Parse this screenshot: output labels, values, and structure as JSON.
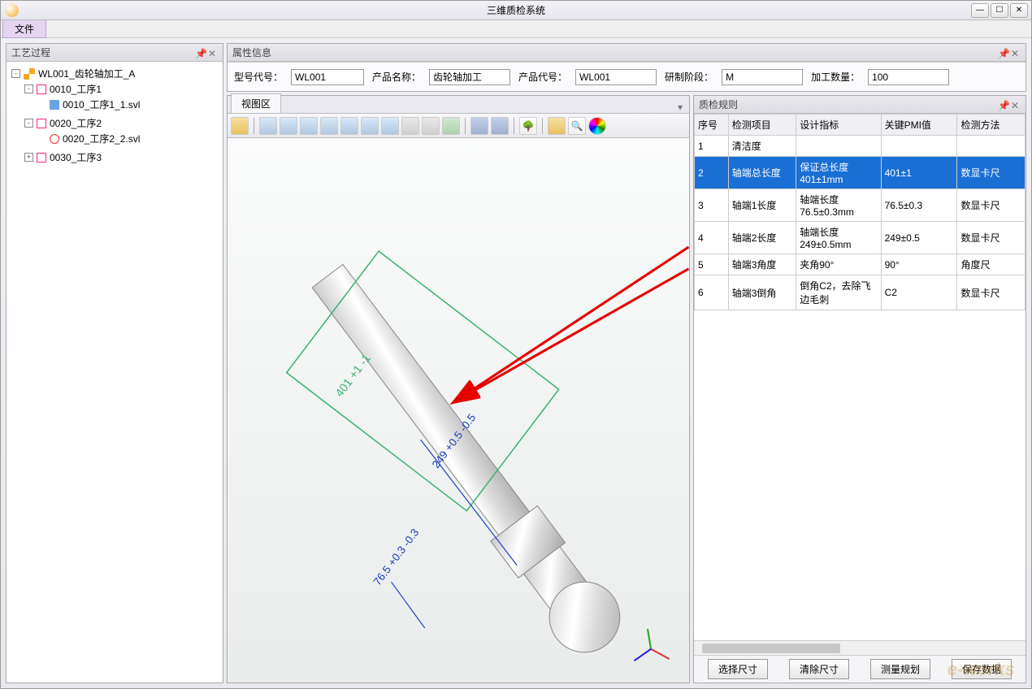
{
  "titlebar": {
    "title": "三维质检系统"
  },
  "menubar": {
    "file": "文件"
  },
  "left": {
    "title": "工艺过程",
    "tree": {
      "root": "WL001_齿轮轴加工_A",
      "n1": "0010_工序1",
      "n1a": "0010_工序1_1.svl",
      "n2": "0020_工序2",
      "n2a": "0020_工序2_2.svl",
      "n3": "0030_工序3"
    }
  },
  "attr": {
    "title": "属性信息",
    "model_code_lbl": "型号代号：",
    "model_code": "WL001",
    "product_name_lbl": "产品名称：",
    "product_name": "齿轮轴加工",
    "product_code_lbl": "产品代号：",
    "product_code": "WL001",
    "phase_lbl": "研制阶段：",
    "phase": "M",
    "qty_lbl": "加工数量：",
    "qty": "100"
  },
  "view": {
    "tab": "视图区"
  },
  "dims": {
    "d401": "401 +1 -1",
    "d249": "249 +0.5 -0.5",
    "d76": "76.5 +0.3 -0.3"
  },
  "rules": {
    "title": "质检规则",
    "cols": {
      "c1": "序号",
      "c2": "检测项目",
      "c3": "设计指标",
      "c4": "关键PMI值",
      "c5": "检测方法"
    },
    "r1": {
      "no": "1",
      "item": "清洁度",
      "design": "",
      "pmi": "",
      "method": ""
    },
    "r2": {
      "no": "2",
      "item": "轴端总长度",
      "design": "保证总长度401±1mm",
      "pmi": "401±1",
      "method": "数显卡尺"
    },
    "r3": {
      "no": "3",
      "item": "轴端1长度",
      "design": "轴端长度76.5±0.3mm",
      "pmi": "76.5±0.3",
      "method": "数显卡尺"
    },
    "r4": {
      "no": "4",
      "item": "轴端2长度",
      "design": "轴端长度249±0.5mm",
      "pmi": "249±0.5",
      "method": "数显卡尺"
    },
    "r5": {
      "no": "5",
      "item": "轴端3角度",
      "design": "夹角90°",
      "pmi": "90°",
      "method": "角度尺"
    },
    "r6": {
      "no": "6",
      "item": "轴端3倒角",
      "design": "倒角C2，去除飞边毛刺",
      "pmi": "C2",
      "method": "数显卡尺"
    },
    "btn_select": "选择尺寸",
    "btn_clear": "清除尺寸",
    "btn_measure": "测量规划",
    "btn_save": "保存数据"
  },
  "watermark": "e-works"
}
